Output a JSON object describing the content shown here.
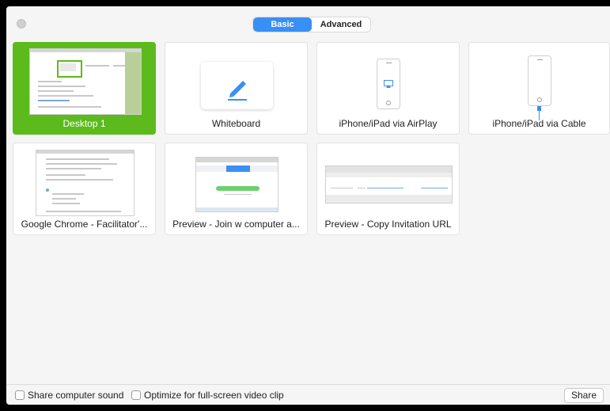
{
  "segmented": {
    "basic": "Basic",
    "advanced": "Advanced",
    "selected": "Basic"
  },
  "tiles": [
    {
      "label": "Desktop 1",
      "selected": true
    },
    {
      "label": "Whiteboard",
      "selected": false
    },
    {
      "label": "iPhone/iPad via AirPlay",
      "selected": false
    },
    {
      "label": "iPhone/iPad via Cable",
      "selected": false
    },
    {
      "label": "Google Chrome - Facilitator'...",
      "selected": false
    },
    {
      "label": "Preview - Join w computer a...",
      "selected": false
    },
    {
      "label": "Preview - Copy Invitation URL",
      "selected": false
    }
  ],
  "bottom": {
    "share_sound": "Share computer sound",
    "optimize_video": "Optimize for full-screen video clip",
    "share_button": "Share"
  },
  "colors": {
    "accent": "#3a8ff5",
    "selected_tile": "#5cba1c"
  }
}
